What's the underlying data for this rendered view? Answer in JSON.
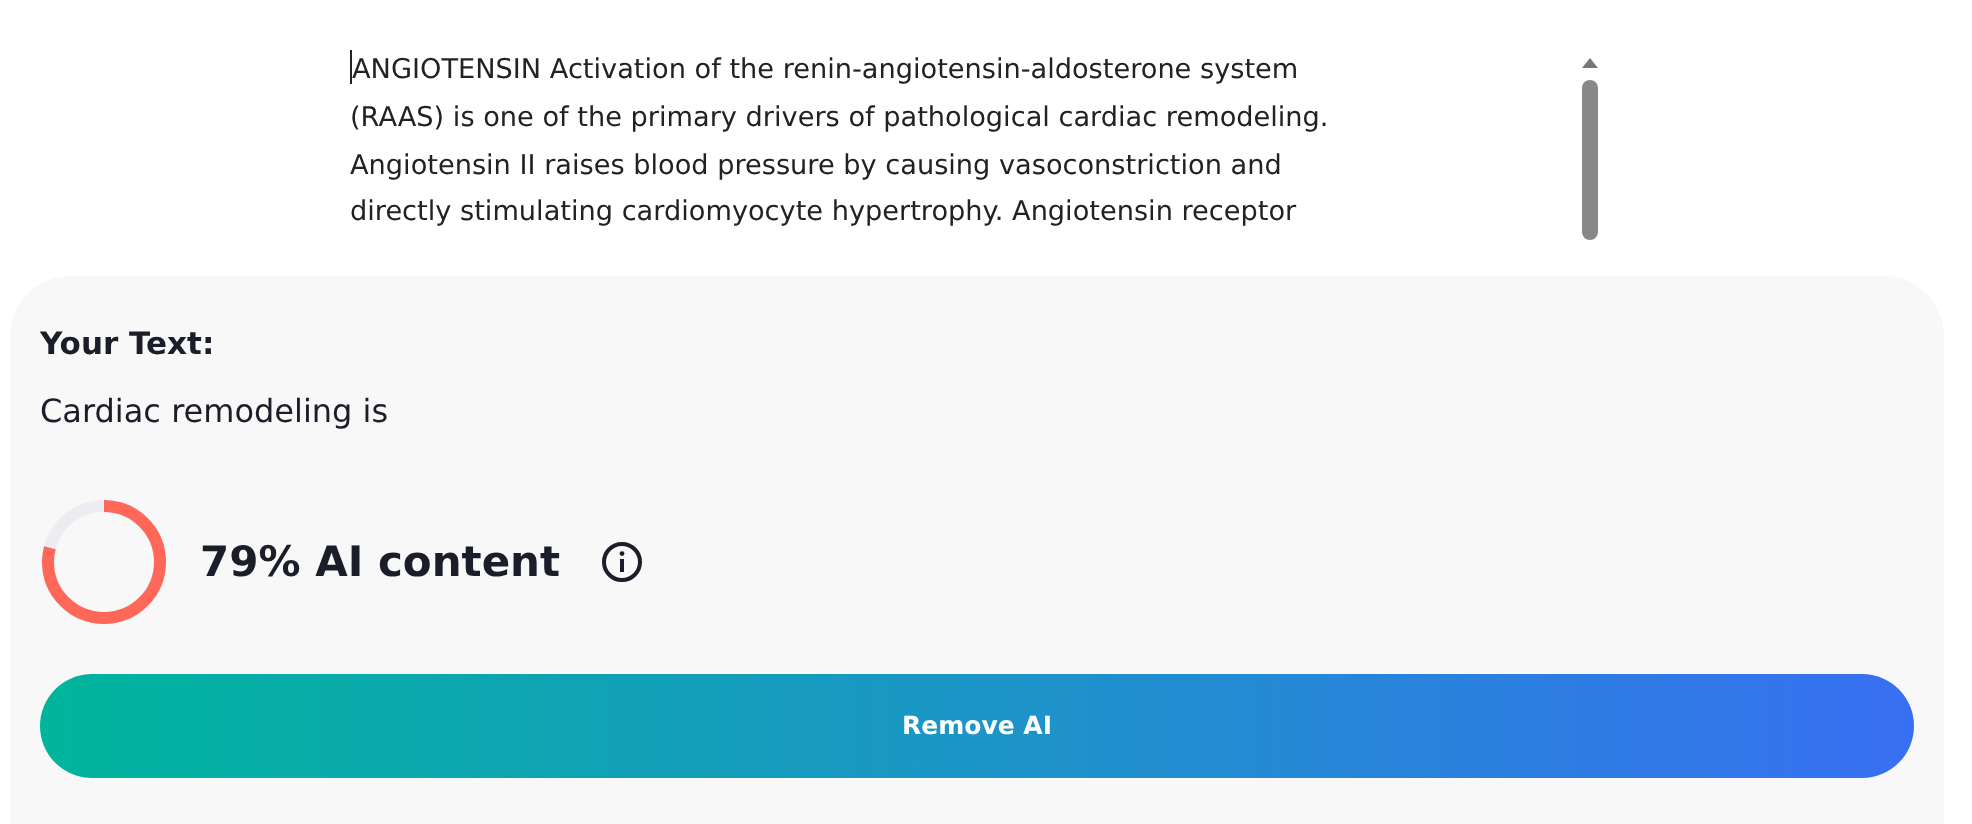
{
  "editor": {
    "lines": [
      "ANGIOTENSIN Activation of the renin-angiotensin-aldosterone system",
      "(RAAS) is one of the primary drivers of pathological cardiac remodeling.",
      "Angiotensin II raises blood pressure by causing vasoconstriction and",
      "directly stimulating cardiomyocyte hypertrophy. Angiotensin receptor"
    ]
  },
  "result": {
    "heading": "Your Text:",
    "text": "Cardiac remodeling is",
    "score": {
      "level": 0.79,
      "label": "79% AI content"
    },
    "button": "Remove AI"
  }
}
